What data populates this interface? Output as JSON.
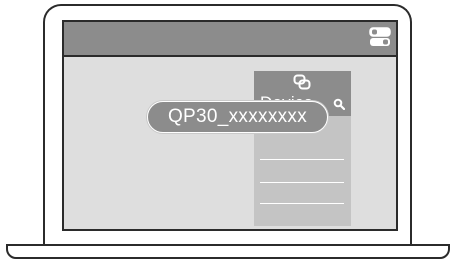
{
  "device_panel": {
    "title": "Device",
    "selected_device": "QP30_xxxxxxxx"
  },
  "icons": {
    "toggle": "toggle-settings-icon",
    "link": "link-icon",
    "search": "search-icon"
  },
  "colors": {
    "titlebar": "#8c8c8c",
    "screen_background": "#dedede",
    "panel": "#c4c4c4",
    "outline": "#2b2b2b"
  }
}
